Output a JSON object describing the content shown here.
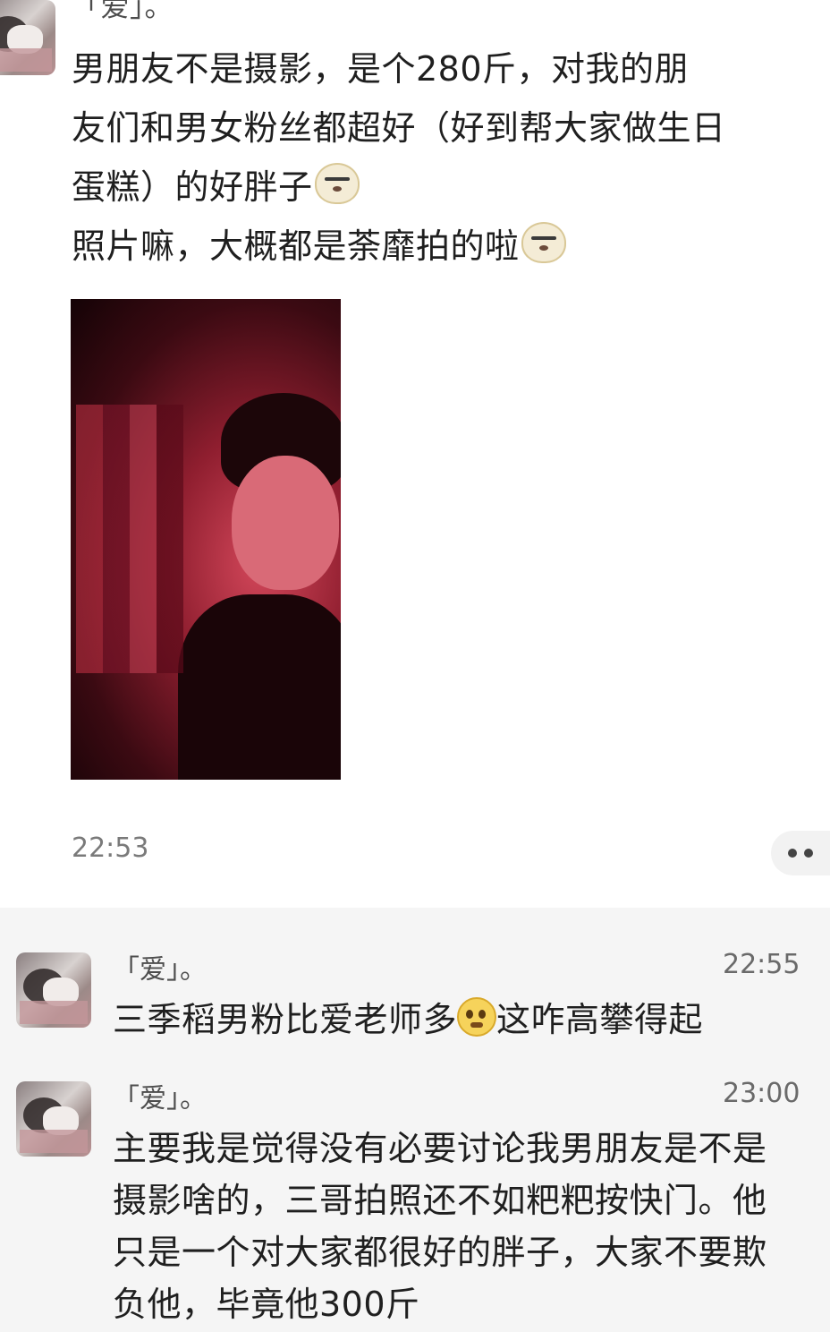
{
  "top_message": {
    "sender_partial": "「爱」。",
    "lines": [
      "男朋友不是摄影，是个280斤，对我的朋",
      "友们和男女粉丝都超好（好到帮大家做生日",
      "蛋糕）的好胖子",
      "照片嘛，大概都是荼靡拍的啦"
    ],
    "time": "22:53",
    "emoji": "doge-face-icon"
  },
  "messages": [
    {
      "sender": "「爱」。",
      "time": "22:55",
      "text_before_emoji": "三季稻男粉比爱老师多",
      "text_after_emoji": "这咋高攀得起",
      "emoji": "crying-face-icon"
    },
    {
      "sender": "「爱」。",
      "time": "23:00",
      "lines": [
        "主要我是觉得没有必要讨论我男朋友是不是",
        "摄影啥的，三哥拍照还不如粑粑按快门。他",
        "只是一个对大家都很好的胖子，大家不要欺",
        "负他，毕竟他300斤"
      ]
    }
  ]
}
